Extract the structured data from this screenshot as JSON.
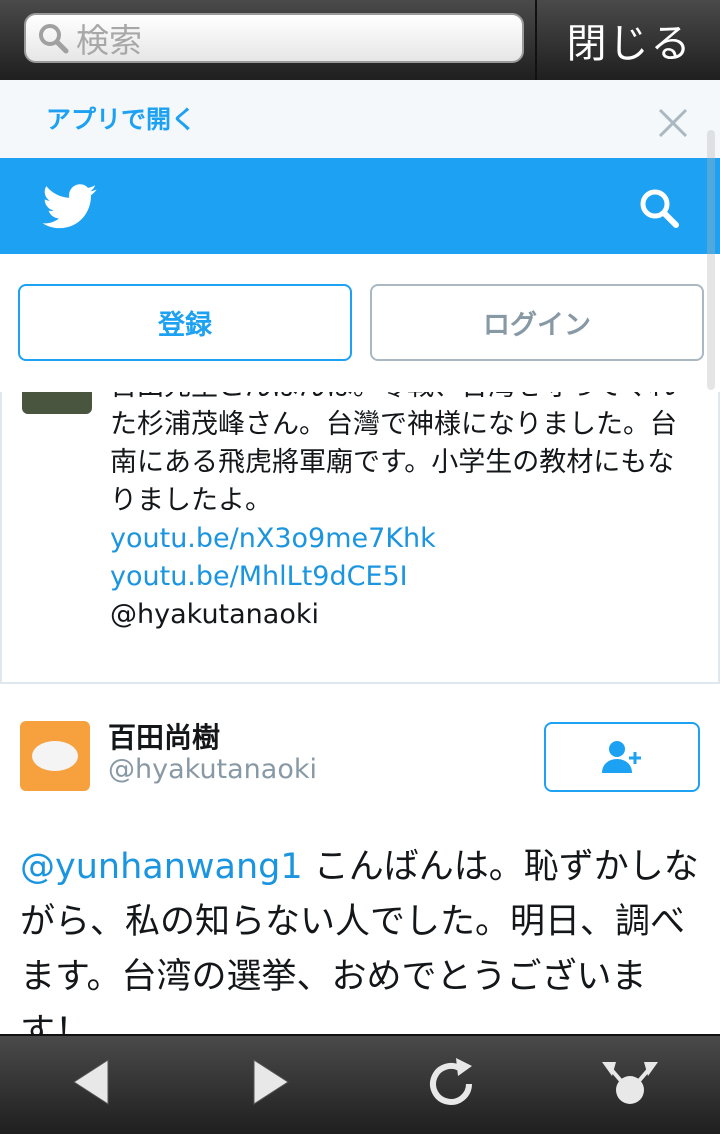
{
  "browser": {
    "search_placeholder": "検索",
    "close_label": "閉じる"
  },
  "banner": {
    "open_in_app": "アプリで開く"
  },
  "auth": {
    "register_label": "登録",
    "login_label": "ログイン"
  },
  "tweet1": {
    "text": "百田先生こんばんは。零戦、台灣を守ってくれた杉浦茂峰さん。台灣で神様になりました。台南にある飛虎將軍廟です。小学生の教材にもなりましたよ。",
    "link1": "youtu.be/nX3o9me7Khk",
    "link2": "youtu.be/MhlLt9dCE5I",
    "mention": "@hyakutanaoki"
  },
  "tweet2": {
    "name": "百田尚樹",
    "handle": "@hyakutanaoki",
    "mention": "@yunhanwang1",
    "text": " こんばんは。恥ずかしながら、私の知らない人でした。明日、調べます。台湾の選挙、おめでとうございます！"
  },
  "colors": {
    "twitter_blue": "#1da1f2",
    "link": "#1b95e0"
  }
}
